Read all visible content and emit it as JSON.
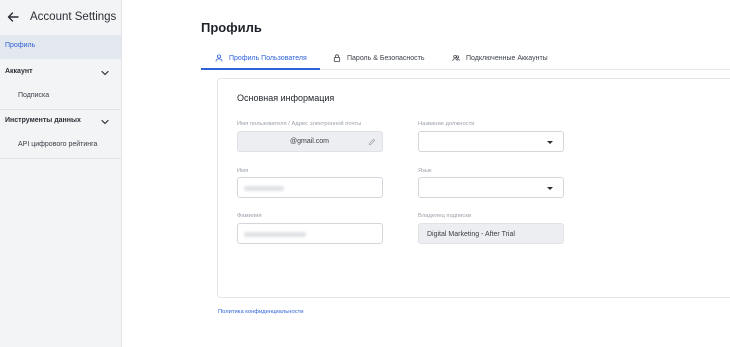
{
  "sidebar": {
    "title": "Account Settings",
    "active_item": "Профиль",
    "groups": [
      {
        "label": "Аккаунт",
        "items": [
          "Подписка"
        ]
      },
      {
        "label": "Инструменты данных",
        "items": [
          "API цифрового рейтинга"
        ]
      }
    ]
  },
  "page": {
    "title": "Профиль"
  },
  "tabs": [
    {
      "label": "Профиль Пользователя",
      "icon": "user-icon",
      "active": true
    },
    {
      "label": "Пароль & Безопасность",
      "icon": "lock-icon",
      "active": false
    },
    {
      "label": "Подключенные Аккаунты",
      "icon": "users-icon",
      "active": false
    }
  ],
  "form": {
    "section_title": "Основная информация",
    "username_label": "Имя пользователя / Адрес электронной почты",
    "username_value": "@gmail.com",
    "job_title_label": "Название должности",
    "job_title_value": "",
    "first_name_label": "Имя",
    "language_label": "Язык",
    "language_value": "",
    "last_name_label": "Фамилия",
    "subscription_owner_label": "Владелец подписки",
    "subscription_owner_value": "Digital Marketing - After Trial"
  },
  "footer": {
    "privacy_link": "Политика конфиденциальности"
  },
  "colors": {
    "accent": "#2f62d8",
    "sidebar_bg": "#f3f4f6",
    "active_bg": "#e3e7ee"
  }
}
